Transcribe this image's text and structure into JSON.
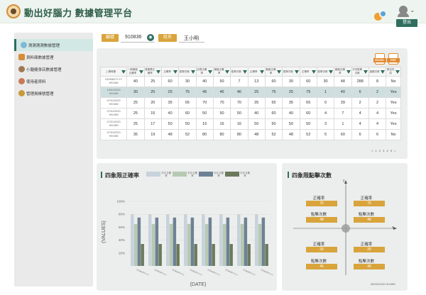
{
  "header": {
    "title": "動出好腦力 數據管理平台",
    "logout_label": "登出"
  },
  "sidebar": {
    "items": [
      {
        "label": "測測測測數據管理",
        "icon": "chat-icon",
        "color": "#7fb8d6",
        "active": true
      },
      {
        "label": "資料庫數據管理",
        "icon": "car-icon",
        "color": "#d58d3a",
        "active": false
      },
      {
        "label": "小腦健身店數據管理",
        "icon": "people-icon",
        "color": "#a07850",
        "active": false
      },
      {
        "label": "使用者資料",
        "icon": "user-icon",
        "color": "#c77b5a",
        "active": false
      },
      {
        "label": "管理員帳號管理",
        "icon": "admin-icon",
        "color": "#c89a3a",
        "active": false
      }
    ]
  },
  "info": {
    "id_label": "編號",
    "id_value": "910836",
    "name_label": "姓名",
    "name_value": "王小明"
  },
  "table": {
    "headers": [
      "上傳時間",
      "一般難度正確率",
      "連連看正確率",
      "正確率",
      "點擊次數",
      "記憶正確率",
      "難度正確率",
      "點擊次數",
      "正確率",
      "難度正確率",
      "點擊次數",
      "正確率",
      "點擊次數",
      "難度正確率",
      "平均點擊次數",
      "遊戲次數",
      "是否完成"
    ],
    "rows": [
      {
        "dt1": "DD/MM/YYYY",
        "dt2": "HH:MM",
        "v": [
          "40",
          "25",
          "60",
          "30",
          "40",
          "50",
          "7",
          "13",
          "60",
          "30",
          "60",
          "30",
          "48",
          "288",
          "8"
        ],
        "done": "No",
        "hl": false
      },
      {
        "dt1": "19/01/2020",
        "dt2": "HH:MM",
        "v": [
          "30",
          "25",
          "25",
          "75",
          "46",
          "46",
          "46",
          "25",
          "75",
          "25",
          "75",
          "1",
          "40",
          "6",
          "2"
        ],
        "done": "Yes",
        "hl": true
      },
      {
        "dt1": "07/01/2020",
        "dt2": "HH:MM",
        "v": [
          "25",
          "20",
          "35",
          "65",
          "70",
          "70",
          "70",
          "35",
          "65",
          "35",
          "65",
          "0",
          "39",
          "2",
          "2"
        ],
        "done": "Yes",
        "hl": false
      },
      {
        "dt1": "07/01/2020",
        "dt2": "HH:MM",
        "v": [
          "25",
          "15",
          "40",
          "60",
          "50",
          "50",
          "50",
          "40",
          "60",
          "40",
          "60",
          "4",
          "7",
          "4",
          "4"
        ],
        "done": "Yes",
        "hl": false
      },
      {
        "dt1": "07/01/2020",
        "dt2": "HH:MM",
        "v": [
          "25",
          "17",
          "50",
          "50",
          "16",
          "16",
          "16",
          "50",
          "50",
          "50",
          "50",
          "3",
          "1",
          "4",
          "4"
        ],
        "done": "Yes",
        "hl": false
      },
      {
        "dt1": "07/01/2020",
        "dt2": "HH:MM",
        "v": [
          "35",
          "19",
          "48",
          "52",
          "80",
          "80",
          "80",
          "48",
          "52",
          "48",
          "52",
          "5",
          "60",
          "6",
          "6"
        ],
        "done": "No",
        "hl": false
      }
    ],
    "pager": "< 1 2 3 4 5 >"
  },
  "file_buttons": [
    {
      "label": "EXCEL",
      "icon": "excel-file-icon"
    },
    {
      "label": "PDF",
      "icon": "pdf-file-icon"
    }
  ],
  "bar_panel": {
    "title": "四象限正確率",
    "legend": [
      {
        "label": "平均 正確率",
        "color": "#c7d2dc"
      },
      {
        "label": "平均 正確率",
        "color": "#b7c9b3"
      },
      {
        "label": "平均 正確率",
        "color": "#6e8295"
      },
      {
        "label": "平均 正確率",
        "color": "#6b7a5c"
      }
    ]
  },
  "chart_data": {
    "type": "bar",
    "categories": [
      "DD/MM/YYYY",
      "DD/MM/YYYY",
      "DD/MM/YYYY",
      "DD/MM/YYYY",
      "DD/MM/YYYY",
      "DD/MM/YYYY",
      "DD/MM/YYYY",
      "DD/MM/YYYY"
    ],
    "series": [
      {
        "values": [
          80,
          80,
          80,
          80,
          80,
          80,
          80,
          80
        ],
        "color": "#c7d2dc"
      },
      {
        "values": [
          65,
          65,
          65,
          65,
          65,
          65,
          65,
          65
        ],
        "color": "#b7c9b3"
      },
      {
        "values": [
          75,
          75,
          75,
          75,
          75,
          75,
          75,
          75
        ],
        "color": "#6e8295"
      },
      {
        "values": [
          34,
          34,
          34,
          34,
          34,
          34,
          34,
          34
        ],
        "color": "#6b7a5c"
      }
    ],
    "yticks": [
      "20%",
      "40%",
      "60%",
      "80%",
      "100%"
    ],
    "ylim": [
      0,
      100
    ],
    "xlabel": "(DATE)",
    "ylabel": "(VALUES)"
  },
  "quad_panel": {
    "title": "四象限點擊次數",
    "axis_x": "x",
    "axis_y": "y",
    "quadrants": [
      {
        "acc_label": "正確率",
        "acc": "75",
        "click_label": "點擊次數",
        "clicks": "48"
      },
      {
        "acc_label": "正確率",
        "acc": "75",
        "click_label": "點擊次數",
        "clicks": "46"
      },
      {
        "acc_label": "正確率",
        "acc": "25",
        "click_label": "點擊次數",
        "clicks": "46"
      },
      {
        "acc_label": "正確率",
        "acc": "25",
        "click_label": "點擊次數",
        "clicks": "46"
      }
    ],
    "timestamp": "08/02/2020 HH:MM"
  }
}
